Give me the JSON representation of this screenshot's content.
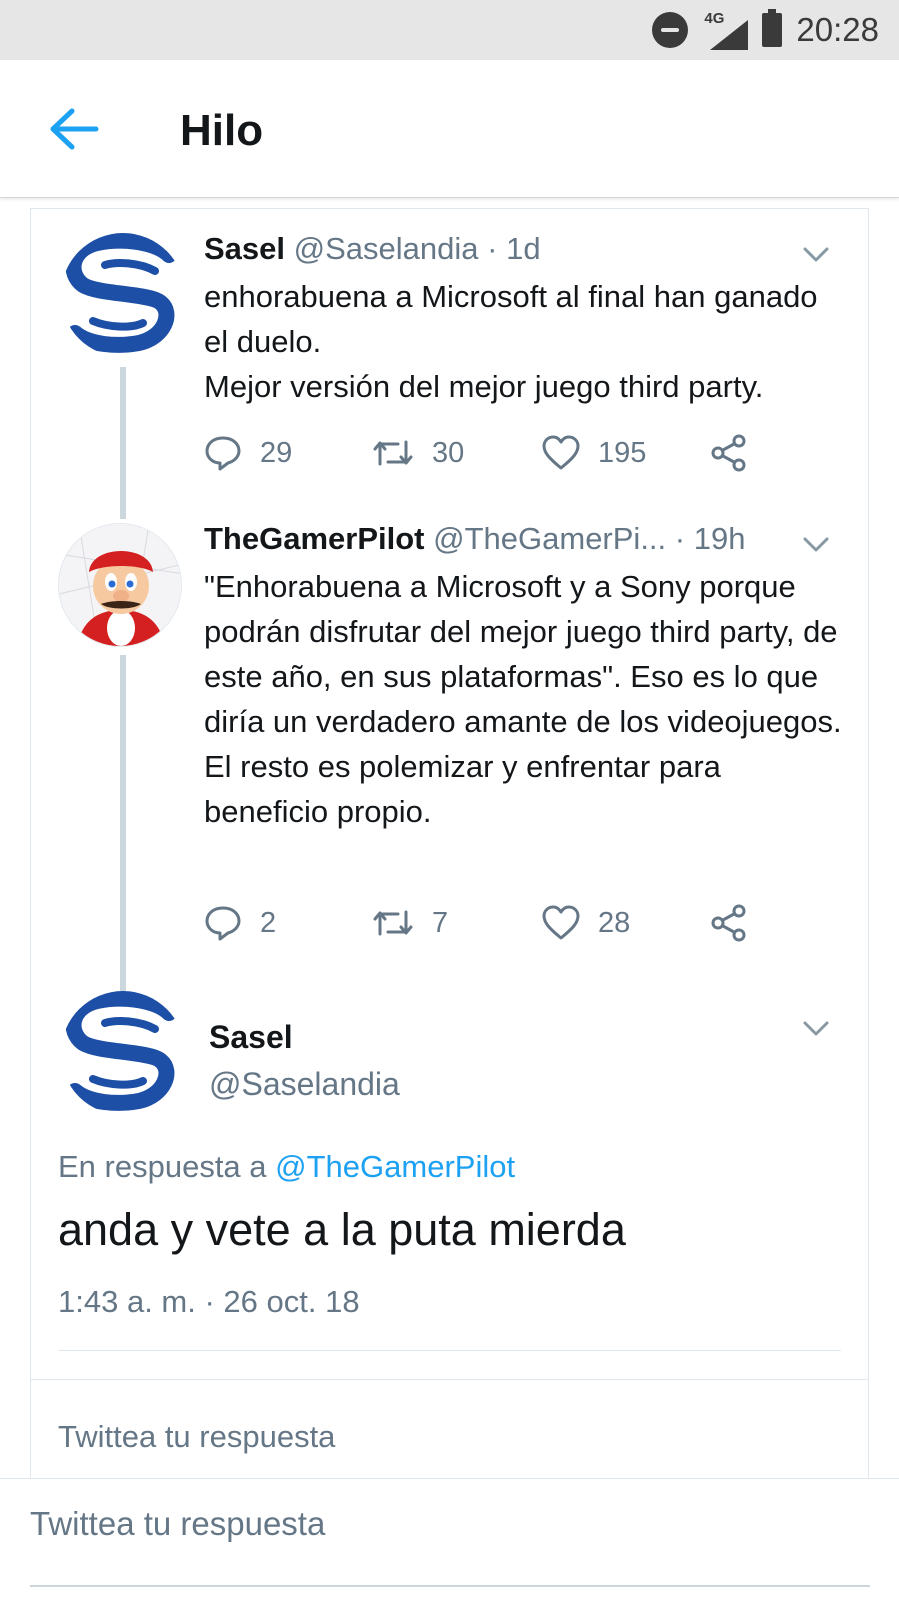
{
  "status_bar": {
    "network": "4G",
    "time": "20:28"
  },
  "header": {
    "title": "Hilo"
  },
  "thread": [
    {
      "name": "Sasel",
      "handle": "@Saselandia",
      "time": "· 1d",
      "text": "enhorabuena a Microsoft al final han ganado el duelo.\nMejor versión del mejor juego third party.",
      "replies": "29",
      "retweets": "30",
      "likes": "195"
    },
    {
      "name": "TheGamerPilot",
      "handle": "@TheGamerPi...",
      "time": "· 19h",
      "text": "\"Enhorabuena a Microsoft y a Sony porque podrán disfrutar del mejor juego third party, de este año, en sus plataformas\". Eso es lo que diría un verdadero amante de los videojuegos. El resto es polemizar y enfrentar para beneficio propio.",
      "replies": "2",
      "retweets": "7",
      "likes": "28"
    }
  ],
  "main_tweet": {
    "name": "Sasel",
    "handle": "@Saselandia",
    "reply_prefix": "En respuesta a",
    "reply_mention": "@TheGamerPilot",
    "text": "anda y vete a la puta mierda",
    "timestamp": "1:43 a. m. · 26 oct. 18"
  },
  "inner_reply_placeholder": "Twittea tu respuesta",
  "compose": {
    "placeholder": "Twittea tu respuesta"
  },
  "colors": {
    "accent": "#1da1f2",
    "muted": "#657786",
    "text": "#14171a",
    "sasel_blue": "#1d4fa6"
  },
  "icons": [
    "arrow-left-icon",
    "reply-icon",
    "retweet-icon",
    "heart-icon",
    "share-icon",
    "chevron-down-icon"
  ]
}
